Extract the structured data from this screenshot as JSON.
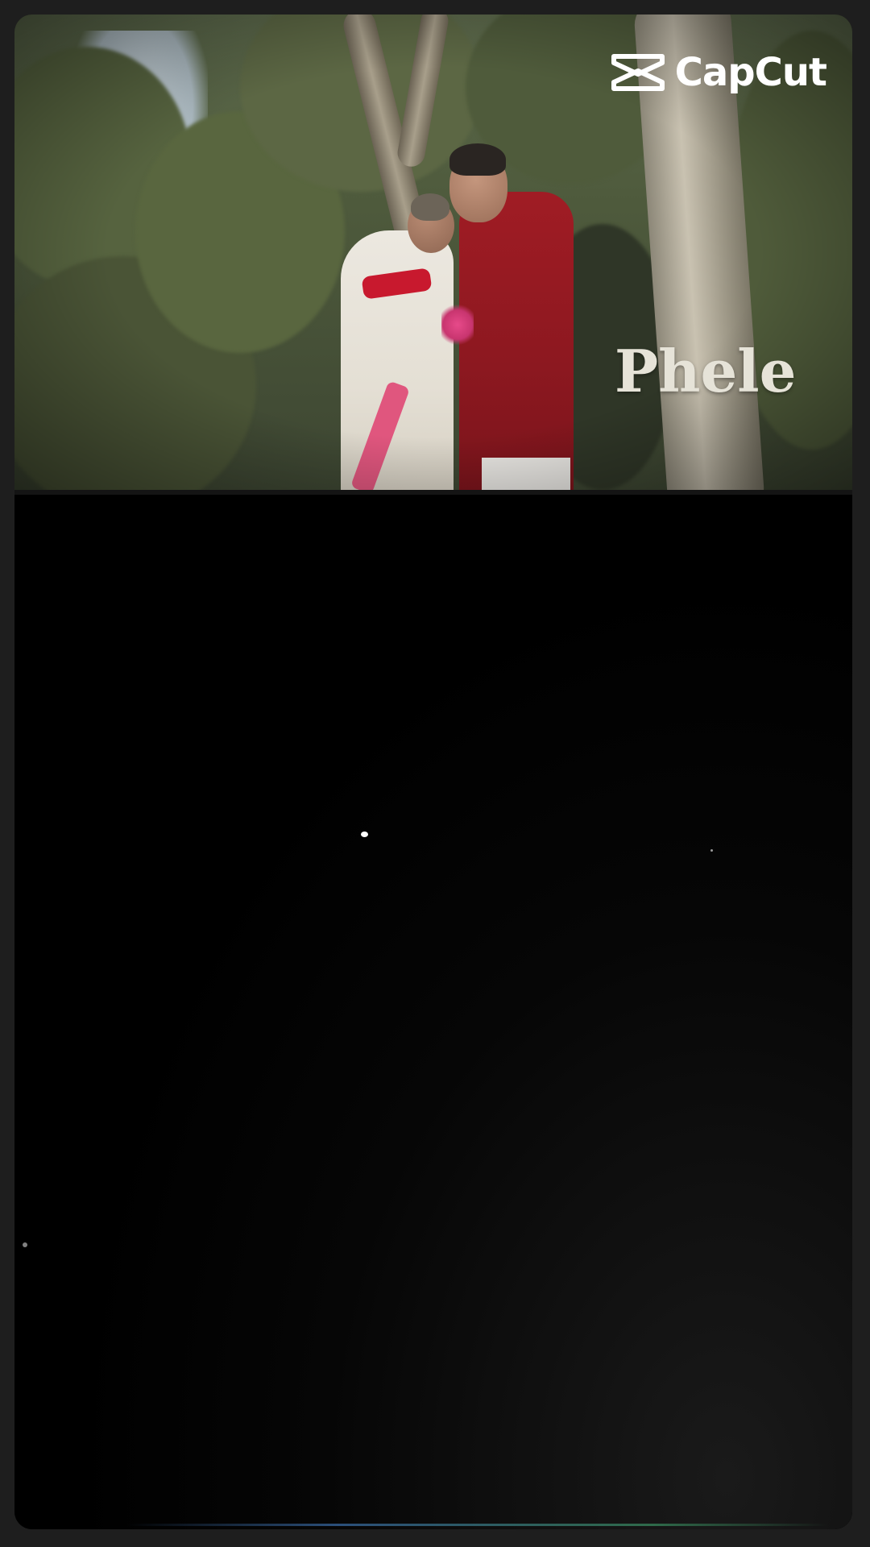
{
  "watermark": {
    "brand": "CapCut",
    "icon": "capcut-logo-icon"
  },
  "overlay": {
    "word": "Phele"
  },
  "colors": {
    "background": "#000000",
    "frame": "#1e1e1e",
    "overlay_text": "#e6e3d8",
    "watermark_text": "#ffffff"
  }
}
